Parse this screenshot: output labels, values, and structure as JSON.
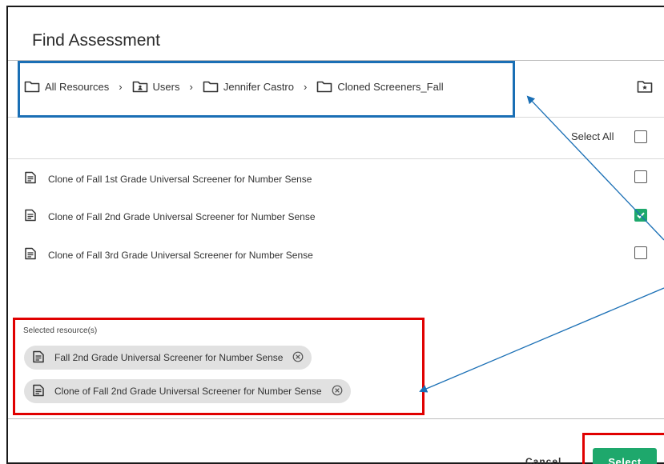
{
  "dialog": {
    "title": "Find Assessment"
  },
  "breadcrumb": {
    "items": [
      {
        "label": "All Resources",
        "icon": "folder-icon"
      },
      {
        "label": "Users",
        "icon": "user-folder-icon"
      },
      {
        "label": "Jennifer Castro",
        "icon": "folder-icon"
      },
      {
        "label": "Cloned Screeners_Fall",
        "icon": "folder-icon"
      }
    ],
    "separator": "›",
    "action_icon": "new-folder-icon"
  },
  "list": {
    "select_all_label": "Select All",
    "select_all_checked": false,
    "items": [
      {
        "label": "Clone of Fall 1st Grade Universal Screener for Number Sense",
        "checked": false,
        "icon": "document-icon"
      },
      {
        "label": "Clone of Fall 2nd Grade Universal Screener for Number Sense",
        "checked": true,
        "icon": "document-icon"
      },
      {
        "label": "Clone of Fall 3rd Grade Universal Screener for Number Sense",
        "checked": false,
        "icon": "document-icon"
      }
    ]
  },
  "selected": {
    "label": "Selected resource(s)",
    "chips": [
      {
        "label": "Fall 2nd Grade Universal Screener for Number Sense",
        "icon": "document-icon"
      },
      {
        "label": "Clone of Fall 2nd Grade Universal Screener for Number Sense",
        "icon": "document-icon"
      }
    ]
  },
  "footer": {
    "cancel_label": "Cancel",
    "select_label": "Select"
  },
  "colors": {
    "accent_green": "#1ea86c",
    "annotation_blue": "#1a6fb5",
    "annotation_red": "#e00000",
    "chip_bg": "#e1e1e1"
  }
}
